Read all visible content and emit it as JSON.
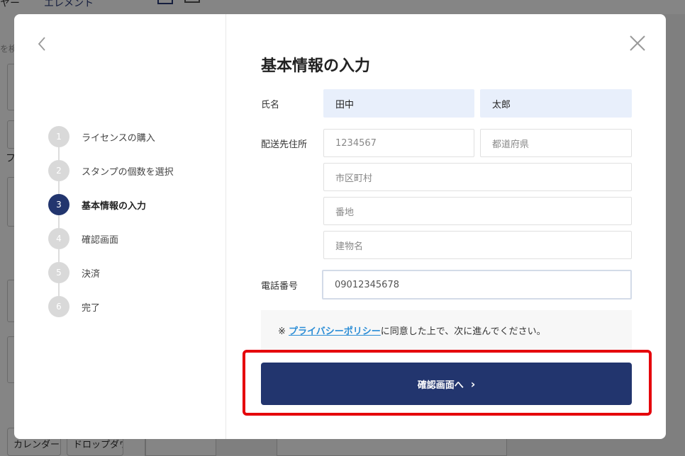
{
  "background_app": {
    "top_left_text": "ヤー",
    "top_tab_text": "エレメント",
    "search_placeholder": "を検",
    "side_char_1": "フ",
    "chips": [
      "カレンダー",
      "ドロップダウン"
    ]
  },
  "modal": {
    "title": "基本情報の入力",
    "steps": [
      {
        "num": "1",
        "label": "ライセンスの購入"
      },
      {
        "num": "2",
        "label": "スタンプの個数を選択"
      },
      {
        "num": "3",
        "label": "基本情報の入力"
      },
      {
        "num": "4",
        "label": "確認画面"
      },
      {
        "num": "5",
        "label": "決済"
      },
      {
        "num": "6",
        "label": "完了"
      }
    ],
    "active_step": 3,
    "form": {
      "name_label": "氏名",
      "last_name_value": "田中",
      "first_name_value": "太郎",
      "address_label": "配送先住所",
      "postal_placeholder": "1234567",
      "prefecture_placeholder": "都道府県",
      "city_placeholder": "市区町村",
      "street_placeholder": "番地",
      "building_placeholder": "建物名",
      "phone_label": "電話番号",
      "phone_placeholder": "09012345678"
    },
    "notice": {
      "prefix": "※ ",
      "link_text": "プライバシーポリシー",
      "suffix": "に同意した上で、次に進んでください。"
    },
    "confirm_button_label": "確認画面へ",
    "confirm_button_chevron": "›"
  },
  "colors": {
    "primary": "#22356e",
    "link": "#2b8dd6",
    "highlight": "#e5000b",
    "filled_field_bg": "#e8effb"
  },
  "icons": {
    "back": "chevron-left-icon",
    "close": "close-icon"
  }
}
